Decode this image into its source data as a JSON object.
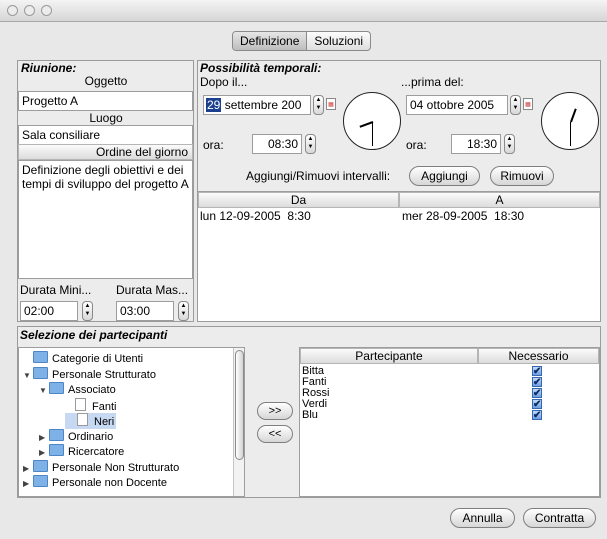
{
  "tabs": {
    "definizione": "Definizione",
    "soluzioni": "Soluzioni"
  },
  "riunione": {
    "title": "Riunione:",
    "oggetto_label": "Oggetto",
    "oggetto_value": "Progetto A",
    "luogo_label": "Luogo",
    "luogo_value": "Sala consiliare",
    "ordine_label": "Ordine del giorno",
    "ordine_value": "Definizione degli obiettivi e dei tempi di sviluppo del progetto A",
    "durata_min_label": "Durata Mini...",
    "durata_max_label": "Durata Mas...",
    "durata_min_value": "02:00",
    "durata_max_value": "03:00"
  },
  "possibilita": {
    "title": "Possibilità temporali:",
    "dopo_label": "Dopo il...",
    "prima_label": "...prima del:",
    "dopo_date_day": "29",
    "dopo_date_rest": " settembre 200",
    "prima_date": "04 ottobre 2005",
    "ora_label": "ora:",
    "dopo_time": "08:30",
    "prima_time": "18:30",
    "intervalli_label": "Aggiungi/Rimuovi intervalli:",
    "aggiungi": "Aggiungi",
    "rimuovi": "Rimuovi",
    "col_da": "Da",
    "col_a": "A",
    "rows": [
      {
        "da": "lun 12-09-2005  8:30",
        "a": "mer 28-09-2005  18:30"
      }
    ]
  },
  "partecipanti": {
    "title": "Selezione dei partecipanti",
    "tree": [
      {
        "label": "Categorie di Utenti",
        "type": "folder",
        "arrow": ""
      },
      {
        "label": "Personale Strutturato",
        "type": "folder",
        "arrow": "▼"
      },
      {
        "label": "Associato",
        "type": "folder",
        "arrow": "▼"
      },
      {
        "label": "Fanti",
        "type": "doc",
        "arrow": ""
      },
      {
        "label": "Neri",
        "type": "doc",
        "arrow": ""
      },
      {
        "label": "Ordinario",
        "type": "folder",
        "arrow": "▶"
      },
      {
        "label": "Ricercatore",
        "type": "folder",
        "arrow": "▶"
      },
      {
        "label": "Personale Non Strutturato",
        "type": "folder",
        "arrow": "▶"
      },
      {
        "label": "Personale non Docente",
        "type": "folder",
        "arrow": "▶"
      }
    ],
    "add_btn": ">>",
    "remove_btn": "<<",
    "col_partecipante": "Partecipante",
    "col_necessario": "Necessario",
    "rows": [
      {
        "name": "Bitta",
        "necessario": true
      },
      {
        "name": "Fanti",
        "necessario": true
      },
      {
        "name": "Rossi",
        "necessario": true
      },
      {
        "name": "Verdi",
        "necessario": true
      },
      {
        "name": "Blu",
        "necessario": true
      }
    ]
  },
  "footer": {
    "annulla": "Annulla",
    "contratta": "Contratta"
  },
  "icons": {
    "window_close": "circle",
    "window_min": "circle",
    "window_max": "circle",
    "check": "✔"
  }
}
